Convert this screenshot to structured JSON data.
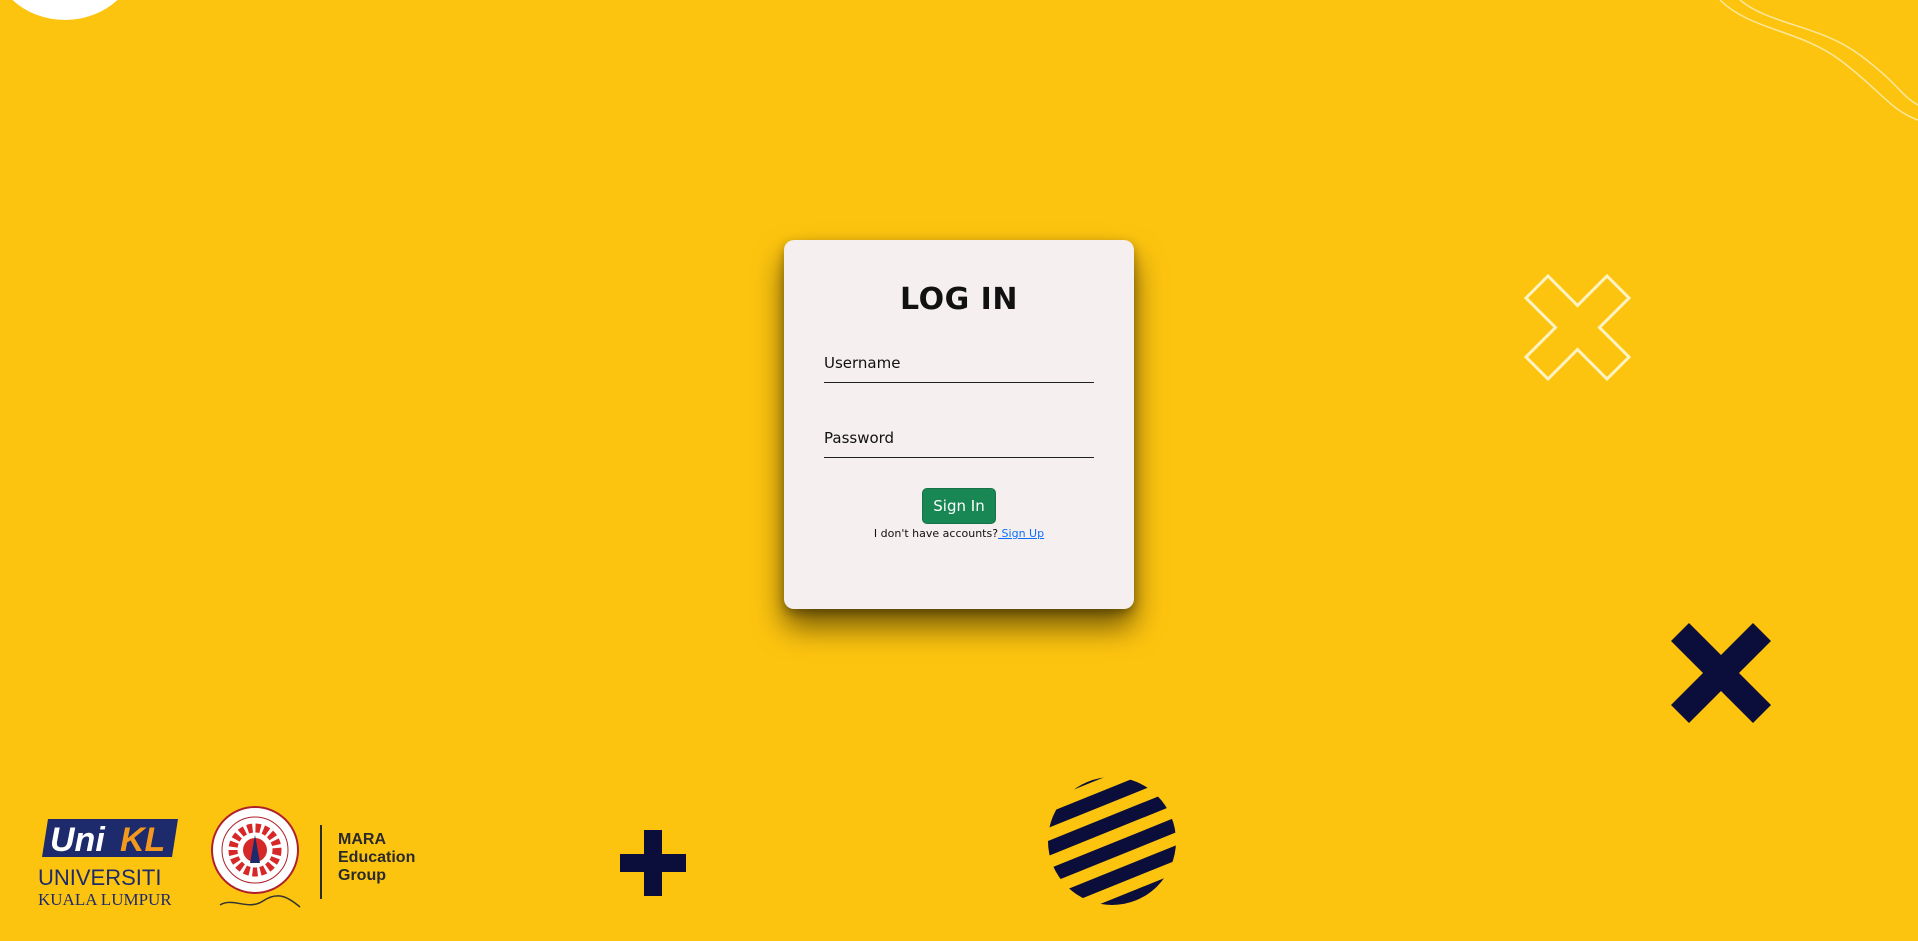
{
  "login": {
    "title": "LOG IN",
    "username_placeholder": "Username",
    "password_placeholder": "Password",
    "signin_label": "Sign In",
    "no_account_text": "I don't have accounts?",
    "signup_link": " Sign Up"
  },
  "logos": {
    "unikl": {
      "uni": "Uni",
      "kl": "KL",
      "line1": "UNIVERSITI",
      "line2": "KUALA LUMPUR"
    },
    "mara": {
      "line1": "MARA",
      "line2": "Education",
      "line3": "Group"
    }
  },
  "colors": {
    "background": "#FDC40F",
    "card": "#F5EFEF",
    "button": "#198754",
    "link": "#0D6EFD",
    "navy": "#0B0E3A"
  }
}
